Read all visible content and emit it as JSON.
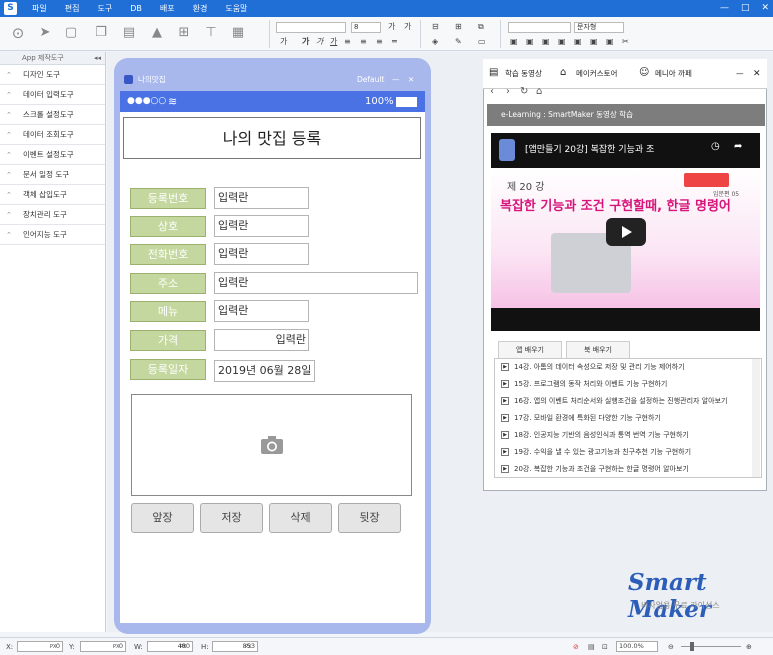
{
  "menu": [
    "파일",
    "편집",
    "도구",
    "DB",
    "배포",
    "환경",
    "도움말"
  ],
  "window_controls": [
    "—",
    "□",
    "✕"
  ],
  "toolbar": {
    "font_size": "8",
    "font_name": "",
    "text_style": "문자형",
    "bold": "가",
    "italic": "가",
    "underline": "가",
    "strike": "가",
    "sub": "가"
  },
  "left_panel": {
    "title": "App 제작도구",
    "pin": "◂◂",
    "items": [
      "디자인 도구",
      "데이터 입력도구",
      "스크롤 설정도구",
      "데이터 조회도구",
      "이벤트 설정도구",
      "문서 일정 도구",
      "객체 삽입도구",
      "장치관리 도구",
      "인어지능 도구"
    ]
  },
  "phone": {
    "title": "나의맛집",
    "default_label": "Default",
    "min": "—",
    "close": "✕",
    "signal": "●●●○○",
    "wifi": "≋",
    "battery": "100%",
    "header": "나의 맛집 등록",
    "fields": [
      {
        "label": "등록번호",
        "value": "입력란"
      },
      {
        "label": "상호",
        "value": "입력란"
      },
      {
        "label": "전화번호",
        "value": "입력란"
      },
      {
        "label": "주소",
        "value": "입력란"
      },
      {
        "label": "메뉴",
        "value": "입력란"
      },
      {
        "label": "가격",
        "value": "입력란"
      },
      {
        "label": "등록일자",
        "value": "2019년 06월 28일"
      }
    ],
    "buttons": [
      "앞장",
      "저장",
      "삭제",
      "뒷장"
    ]
  },
  "right_panel": {
    "tabs": [
      "학습 동영상",
      "메이커스토어",
      "메니아 까페"
    ],
    "minimize": "—",
    "close": "✕",
    "elearning": "e-Learning : SmartMaker 동영상 학습",
    "video": {
      "title": "[앱만들기 20강] 복잡한 기능과 조",
      "lecture": "제 20 강",
      "subtitle": "복잡한 기능과 조건 구현할때, 한글 명령어",
      "badge": "입문편 05"
    },
    "subtabs": [
      "앱 배우기",
      "북 배우기"
    ],
    "list": [
      "14강. 아톰의 데이터 속성으로 저장 및 관리 기능 제어하기",
      "15강. 프로그램의 동작 처리와 이벤트 기능 구현하기",
      "16강. 앱의 이벤트 처리순서와 실행조건을 설정하는 진행관리자 알아보기",
      "17강. 모바일 환경에 특화된 다양한 기능 구현하기",
      "18강. 인공지능 기반의 음성인식과 통역 번역 기능 구현하기",
      "19강. 수익을 낼 수 있는 광고기능과 친구추천 기능 구현하기",
      "20강. 복잡한 기능과 조건을 구현하는 한글 명령어 알아보기"
    ]
  },
  "brand": {
    "name": "Smart Maker",
    "sub": "비사업용 무료 라이선스"
  },
  "bottom": {
    "x_label": "X:",
    "x_value": "0",
    "y_label": "Y:",
    "y_value": "0",
    "w_label": "W:",
    "w_value": "480",
    "h_label": "H:",
    "h_value": "853",
    "unit": "PX",
    "zoom": "100.0%"
  },
  "colors": {
    "accent": "#1f6fd6",
    "phone_frame": "#a8b7ec",
    "statusbar": "#4a72e4",
    "label_bg": "#c4d79e"
  }
}
